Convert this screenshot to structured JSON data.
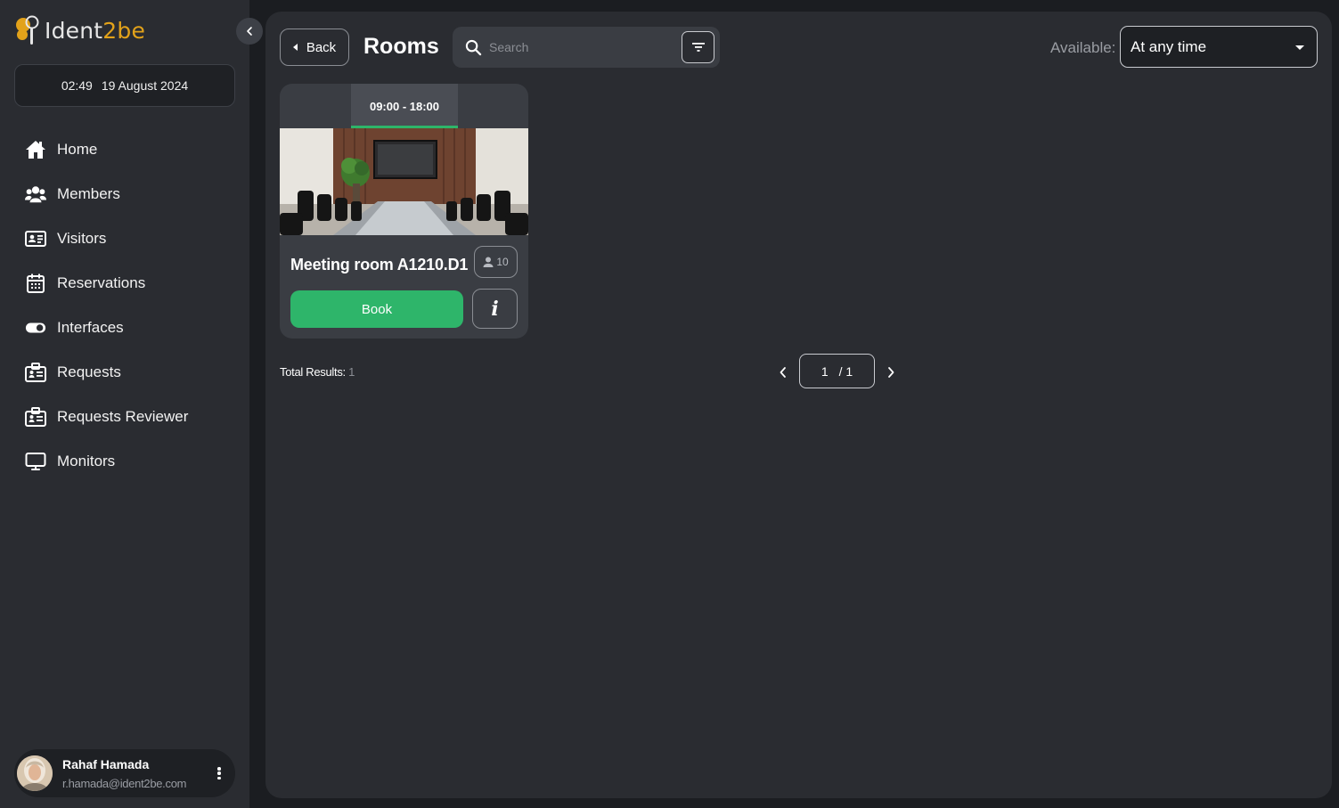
{
  "app": {
    "logo_text_a": "Ident",
    "logo_text_b": "2be",
    "date_time": {
      "time": "02:49",
      "date": "19 August 2024"
    }
  },
  "sidebar": {
    "items": [
      {
        "label": "Home",
        "icon": "home-icon"
      },
      {
        "label": "Members",
        "icon": "members-icon"
      },
      {
        "label": "Visitors",
        "icon": "id-card-icon"
      },
      {
        "label": "Reservations",
        "icon": "calendar-icon"
      },
      {
        "label": "Interfaces",
        "icon": "toggle-icon"
      },
      {
        "label": "Requests",
        "icon": "request-icon"
      },
      {
        "label": "Requests Reviewer",
        "icon": "request-reviewer-icon"
      },
      {
        "label": "Monitors",
        "icon": "monitor-icon"
      }
    ]
  },
  "user": {
    "name": "Rahaf Hamada",
    "email": "r.hamada@ident2be.com"
  },
  "header": {
    "back_label": "Back",
    "title": "Rooms",
    "search_placeholder": "Search",
    "available_label": "Available:",
    "available_value": "At any time"
  },
  "rooms": [
    {
      "time": "09:00 - 18:00",
      "name": "Meeting room A1210.D1",
      "capacity": "10",
      "book_label": "Book",
      "info_label": "i"
    }
  ],
  "results": {
    "label": "Total Results:",
    "count": "1"
  },
  "pagination": {
    "current": "1",
    "total": "/ 1"
  },
  "colors": {
    "accent_green": "#2eb56a",
    "logo_orange": "#e2a21a",
    "panel": "#2a2c31",
    "background": "#1b1d21"
  }
}
